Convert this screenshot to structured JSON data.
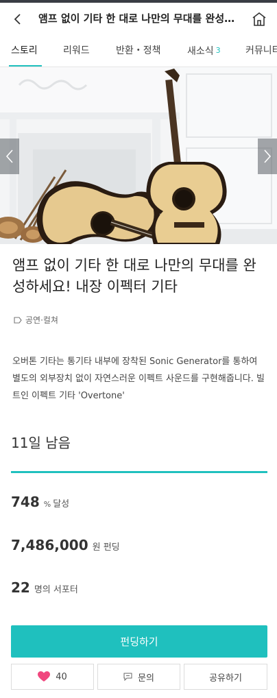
{
  "header": {
    "title": "앰프 없이 기타 한 대로 나만의 무대를 완성하세요! 내장 이펙터 기타",
    "back_icon": "chevron-left-icon",
    "home_icon": "home-icon"
  },
  "tabs": [
    {
      "label": "스토리",
      "active": true
    },
    {
      "label": "리워드"
    },
    {
      "label": "반환・정책"
    },
    {
      "label": "새소식",
      "count": "3"
    },
    {
      "label": "커뮤니티"
    }
  ],
  "hero": {
    "prev_icon": "chevron-left-icon",
    "next_icon": "chevron-right-icon"
  },
  "project": {
    "title": "앰프 없이 기타 한 대로 나만의 무대를 완성하세요! 내장 이펙터 기타",
    "category": "공연·컬쳐",
    "description": "오버톤 기타는 통기타 내부에 장착된 Sonic Generator를 통하여 별도의 외부장치 없이 자연스러운 이펙트 사운드를 구현해줍니다. 빌트인 이펙트 기타 'Overtone'"
  },
  "stats": {
    "days_left": "11일 남음",
    "progress_percent": 100,
    "achieved_value": "748",
    "achieved_unit": "%",
    "achieved_label": "달성",
    "funding_value": "7,486,000",
    "funding_label": "원 펀딩",
    "supporters_value": "22",
    "supporters_label": "명의 서포터"
  },
  "actions": {
    "fund_label": "펀딩하기",
    "like_count": "40",
    "inquiry_label": "문의",
    "share_label": "공유하기"
  },
  "colors": {
    "accent": "#1fc0be",
    "like": "#f0477e"
  }
}
